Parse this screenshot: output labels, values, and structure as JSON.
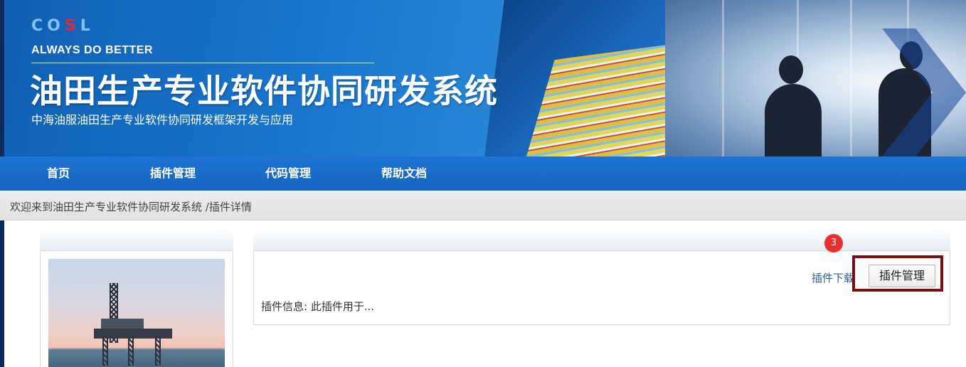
{
  "banner": {
    "logo_text_1": "CO",
    "logo_text_red": "S",
    "logo_text_2": "L",
    "tagline": "ALWAYS DO BETTER",
    "system_title": "油田生产专业软件协同研发系统",
    "system_subtitle": "中海油服油田生产专业软件协同研发框架开发与应用"
  },
  "nav": {
    "items": [
      {
        "label": "首页"
      },
      {
        "label": "插件管理"
      },
      {
        "label": "代码管理"
      },
      {
        "label": "帮助文档"
      }
    ]
  },
  "breadcrumb": {
    "text": "欢迎来到油田生产专业软件协同研发系统 /插件详情"
  },
  "plugin": {
    "download_label": "插件下载",
    "manage_button_label": "插件管理",
    "info_text": "插件信息: 此插件用于..."
  },
  "annotation": {
    "step_number": "3",
    "highlight_color": "#7a0c14",
    "badge_color": "#e8312f"
  },
  "colors": {
    "nav_blue": "#1a6cc8",
    "banner_blue": "#1a78cf"
  }
}
